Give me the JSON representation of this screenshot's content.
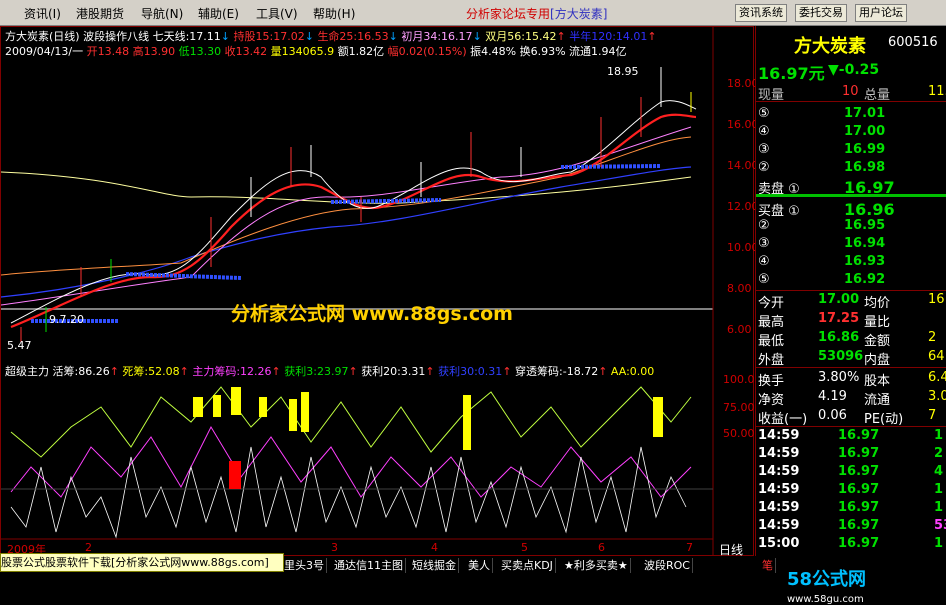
{
  "menu": {
    "items": [
      "资讯(I)",
      "港股期货",
      "导航(N)",
      "辅助(E)",
      "工具(V)",
      "帮助(H)"
    ],
    "title": "分析家论坛专用",
    "title_badge": "[方大炭素]",
    "sys_buttons": [
      "资讯系统",
      "委托交易",
      "用户论坛"
    ]
  },
  "chart": {
    "header_line1": {
      "name": "方大炭素(日线)",
      "indicator": "波段操作八线",
      "qx": "七天线:17.11",
      "cs": "持股15:17.02",
      "sm": "生命25:16.53",
      "cy": "初月34:16.17",
      "sy": "双月56:15.42",
      "bn": "半年120:14.01"
    },
    "header_line2": {
      "date": "2009/04/13/一",
      "open": "开13.48",
      "high": "高13.90",
      "low": "低13.30",
      "close": "收13.42",
      "vol": "量134065.9",
      "amt": "额1.82亿",
      "chg": "幅0.02(0.15%)",
      "amp": "振4.48%",
      "turn": "换6.93%",
      "float": "流通1.94亿"
    },
    "high_mark": "18.95",
    "low_mark": "5.47",
    "mark_7": "9.7.20",
    "y_axis": [
      "18.00",
      "16.00",
      "14.00",
      "12.00",
      "10.00",
      "8.00",
      "6.00"
    ],
    "sub_header": {
      "name": "超级主力",
      "jc": "活筹:86.26",
      "sc": "死筹:52.08",
      "zl": "主力筹码:12.26",
      "hl3": "获利3:23.97",
      "hl20": "获利20:3.31",
      "hl30": "获利30:0.31",
      "ct": "穿透筹码:-18.72",
      "aa": "AA:0.00"
    },
    "sub_y_axis": [
      "100.0",
      "75.00",
      "50.00"
    ],
    "x_axis": [
      "2009年",
      "2",
      "3",
      "4",
      "5",
      "6",
      "7"
    ],
    "period": "日线",
    "watermark": "分析家公式网 www.88gs.com"
  },
  "quote": {
    "name": "方大炭素",
    "code": "600516",
    "price": "16.97元",
    "change": "▼-0.25",
    "now_vol_label": "现量",
    "now_vol": "10",
    "total_label": "总量",
    "total": "11.",
    "sell": [
      {
        "lvl": "⑤",
        "p": "17.01"
      },
      {
        "lvl": "④",
        "p": "17.00"
      },
      {
        "lvl": "③",
        "p": "16.99"
      },
      {
        "lvl": "②",
        "p": "16.98"
      },
      {
        "lvl": "卖盘 ①",
        "p": "16.97"
      }
    ],
    "buy": [
      {
        "lvl": "买盘 ①",
        "p": "16.96"
      },
      {
        "lvl": "②",
        "p": "16.95"
      },
      {
        "lvl": "③",
        "p": "16.94"
      },
      {
        "lvl": "④",
        "p": "16.93"
      },
      {
        "lvl": "⑤",
        "p": "16.92"
      }
    ],
    "stats": [
      {
        "l1": "今开",
        "v1": "17.00",
        "l2": "均价",
        "v2": "16"
      },
      {
        "l1": "最高",
        "v1": "17.25",
        "l2": "量比",
        "v2": ""
      },
      {
        "l1": "最低",
        "v1": "16.86",
        "l2": "金额",
        "v2": "2"
      },
      {
        "l1": "外盘",
        "v1": "53096",
        "l2": "内盘",
        "v2": "64"
      }
    ],
    "stats2": [
      {
        "l1": "换手",
        "v1": "3.80%",
        "l2": "股本",
        "v2": "6.4"
      },
      {
        "l1": "净资",
        "v1": "4.19",
        "l2": "流通",
        "v2": "3.0"
      },
      {
        "l1": "收益(一)",
        "v1": "0.06",
        "l2": "PE(动)",
        "v2": "7"
      }
    ],
    "ticks": [
      {
        "t": "14:59",
        "p": "16.97",
        "v": "1"
      },
      {
        "t": "14:59",
        "p": "16.97",
        "v": "2"
      },
      {
        "t": "14:59",
        "p": "16.97",
        "v": "4"
      },
      {
        "t": "14:59",
        "p": "16.97",
        "v": "1"
      },
      {
        "t": "14:59",
        "p": "16.97",
        "v": "1"
      },
      {
        "t": "14:59",
        "p": "16.97",
        "v": "53"
      },
      {
        "t": "15:00",
        "p": "16.97",
        "v": "1"
      }
    ]
  },
  "tabs": [
    "里头3号",
    "通达信11主图",
    "短线掘金",
    "美人",
    "买卖点KDJ",
    "★利多买卖★",
    "波段ROC"
  ],
  "status_text": "股票公式股票软件下载[分析家公式网www.88gs.com]",
  "tab_right": "笔",
  "logo": "58公式网",
  "logo_url": "www.58gu.com",
  "colors": {
    "up": "#ff3030",
    "down": "#00e000",
    "yellow": "#ffff00",
    "axis": "#d00000"
  }
}
